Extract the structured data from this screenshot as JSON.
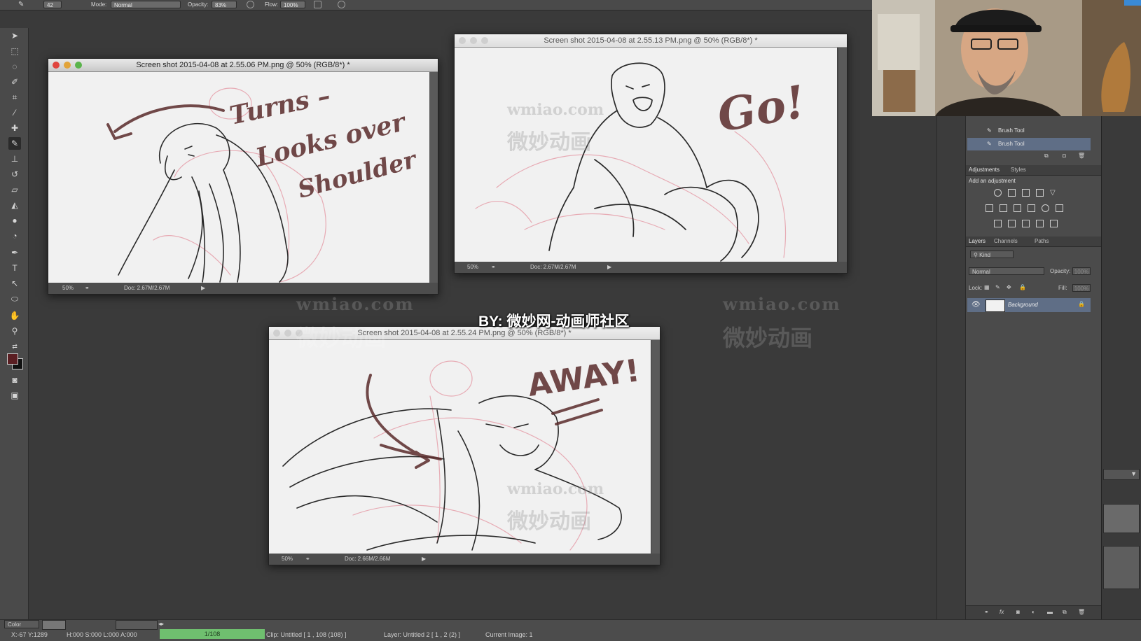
{
  "options_bar": {
    "brush_size": "42",
    "mode_label": "Mode:",
    "mode_value": "Normal",
    "opacity_label": "Opacity:",
    "opacity_value": "83%",
    "flow_label": "Flow:",
    "flow_value": "100%"
  },
  "tools": [
    "move-tool-icon",
    "marquee-tool-icon",
    "lasso-tool-icon",
    "quick-select-tool-icon",
    "crop-tool-icon",
    "eyedropper-tool-icon",
    "healing-brush-tool-icon",
    "brush-tool-icon",
    "clone-stamp-tool-icon",
    "history-brush-tool-icon",
    "eraser-tool-icon",
    "paint-bucket-tool-icon",
    "dodge-tool-icon",
    "blur-tool-icon",
    "pen-tool-icon",
    "type-tool-icon",
    "path-select-tool-icon",
    "ellipse-tool-icon",
    "hand-tool-icon",
    "zoom-tool-icon"
  ],
  "colors": {
    "foreground": "#5a1e22",
    "background": "#111111",
    "selection": "#5f6e86",
    "pencil": "#2a2a2a",
    "red_pencil": "#e59aa6",
    "lettering": "#5a2b2b"
  },
  "windows": [
    {
      "title": "Screen shot 2015-04-08 at 2.55.06 PM.png @ 50% (RGB/8*) *",
      "zoom": "50%",
      "doc": "Doc: 2.67M/2.67M",
      "lettering": [
        "Turns –",
        "Looks over",
        "Shoulder"
      ]
    },
    {
      "title": "Screen shot 2015-04-08 at 2.55.13 PM.png @ 50% (RGB/8*) *",
      "zoom": "50%",
      "doc": "Doc: 2.67M/2.67M",
      "lettering": [
        "Go!"
      ]
    },
    {
      "title": "Screen shot 2015-04-08 at 2.55.24 PM.png @ 50% (RGB/8*) *",
      "zoom": "50%",
      "doc": "Doc: 2.66M/2.66M",
      "lettering": [
        "AWAY!"
      ]
    }
  ],
  "caption": "BY: 微妙网-动画师社区",
  "watermarks": {
    "url": "wmiao.com",
    "cn": "微妙动画"
  },
  "history": {
    "rows": [
      "Brush Tool",
      "Brush Tool"
    ]
  },
  "adjustments": {
    "tabs": [
      "Adjustments",
      "Styles"
    ],
    "hint": "Add an adjustment"
  },
  "layers": {
    "tabs": [
      "Layers",
      "Channels",
      "Paths"
    ],
    "kind": "Kind",
    "blend": "Normal",
    "opacity_label": "Opacity:",
    "opacity_value": "100%",
    "lock_label": "Lock:",
    "fill_label": "Fill:",
    "fill_value": "100%",
    "rows": [
      {
        "name": "Background",
        "visible": true,
        "locked": true
      }
    ]
  },
  "status": {
    "coords": "X:-67  Y:1289",
    "hsl": "H:000  S:000  L:000  A:000",
    "frame": "1/108",
    "clip": "Clip: Untitled [ 1 , 108  (108) ]",
    "layer": "Layer: Untitled 2 [ 1 , 2  (2) ]",
    "current": "Current Image: 1",
    "color_mode": "Color"
  }
}
